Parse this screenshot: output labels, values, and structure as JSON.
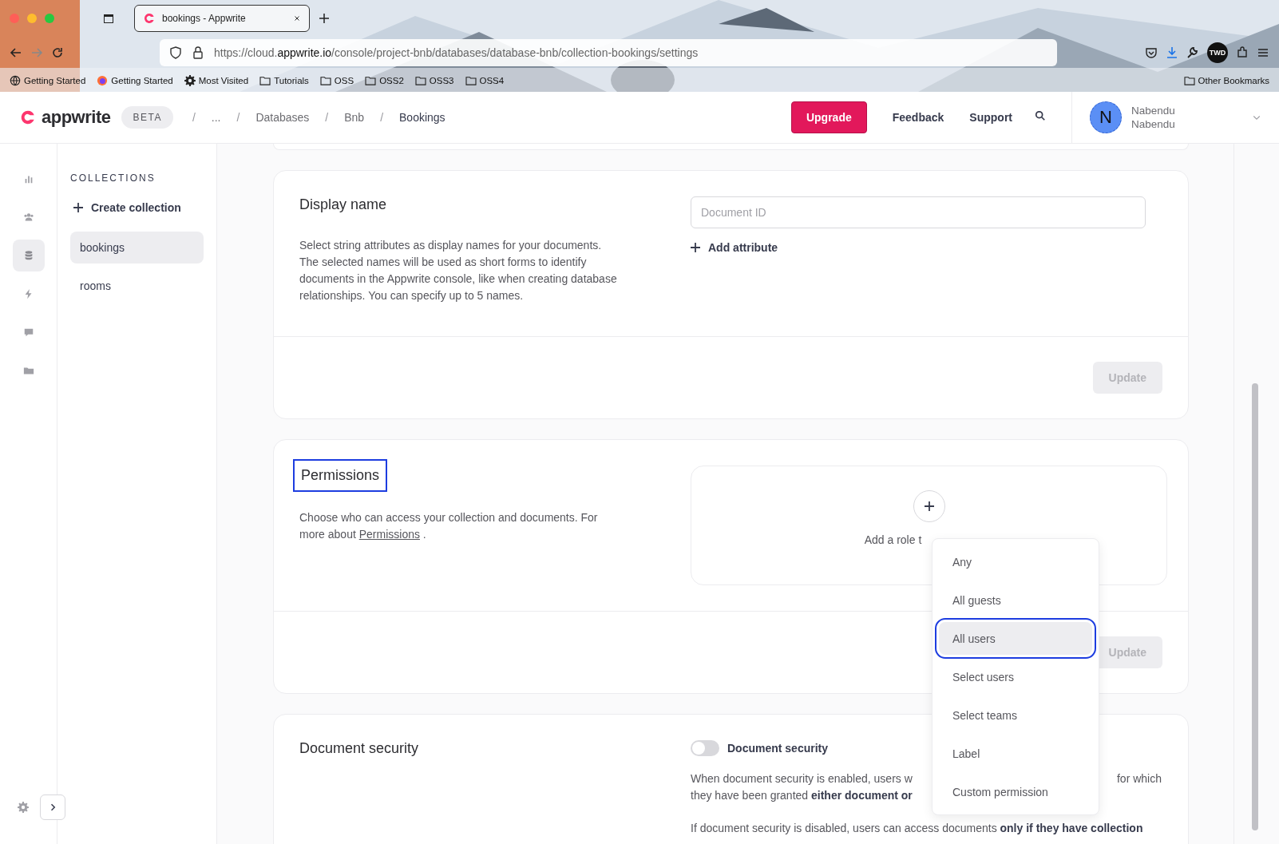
{
  "browser": {
    "tab": {
      "title": "bookings - Appwrite",
      "selected": true
    },
    "url": {
      "prefix": "https://cloud.",
      "domain": "appwrite.io",
      "path": "/console/project-bnb/databases/database-bnb/collection-bookings/settings"
    },
    "bookmarks": [
      {
        "kind": "globe",
        "label": "Getting Started"
      },
      {
        "kind": "fox",
        "label": "Getting Started"
      },
      {
        "kind": "gear",
        "label": "Most Visited"
      },
      {
        "kind": "folder",
        "label": "Tutorials"
      },
      {
        "kind": "folder",
        "label": "OSS"
      },
      {
        "kind": "folder",
        "label": "OSS2"
      },
      {
        "kind": "folder",
        "label": "OSS3"
      },
      {
        "kind": "folder",
        "label": "OSS4"
      }
    ],
    "other_bookmarks": "Other Bookmarks",
    "extension_badge": "TWD"
  },
  "header": {
    "logo": "appwrite",
    "badge": "BETA",
    "separator": "/",
    "breadcrumbs": [
      "...",
      "Databases",
      "Bnb",
      "Bookings"
    ],
    "upgrade": "Upgrade",
    "links": [
      "Feedback",
      "Support"
    ],
    "user": {
      "initial": "N",
      "name": "Nabendu",
      "subtitle": "Nabendu"
    }
  },
  "rail": [
    {
      "kind": "chart",
      "selected": false
    },
    {
      "kind": "people",
      "selected": false
    },
    {
      "kind": "database",
      "selected": true
    },
    {
      "kind": "bolt",
      "selected": false
    },
    {
      "kind": "chat",
      "selected": false
    },
    {
      "kind": "folder",
      "selected": false
    }
  ],
  "sidebar": {
    "title": "COLLECTIONS",
    "create": "Create collection",
    "items": [
      {
        "label": "bookings",
        "selected": true
      },
      {
        "label": "rooms",
        "selected": false
      }
    ]
  },
  "display_name": {
    "title": "Display name",
    "description": "Select string attributes as display names for your documents. The selected names will be used as short forms to identify documents in the Appwrite console, like when creating database relationships. You can specify up to 5 names.",
    "field": {
      "placeholder": "Document ID"
    },
    "add": "Add attribute",
    "button": {
      "label": "Update",
      "disabled": true
    }
  },
  "permissions": {
    "title": "Permissions",
    "title_highlighted": true,
    "description": "Choose who can access your collection and documents. For more about",
    "link": "Permissions",
    "after_link": ".",
    "add_role": "Add a role t",
    "button": {
      "label": "Update",
      "disabled": true
    },
    "menu": [
      {
        "label": "Any",
        "selected": false
      },
      {
        "label": "All guests",
        "selected": false
      },
      {
        "label": "All users",
        "selected": true
      },
      {
        "label": "Select users",
        "selected": false
      },
      {
        "label": "Select teams",
        "selected": false
      },
      {
        "label": "Label",
        "selected": false
      },
      {
        "label": "Custom permission",
        "selected": false
      }
    ]
  },
  "document_security": {
    "title": "Document security",
    "toggle": {
      "label": "Document security",
      "on": false
    },
    "line_1": [
      "When document security is enabled, users w",
      "for which"
    ],
    "line_2": "they have been granted **either document or**",
    "line_3": "If document security is disabled, users can access documents **only if they have collection**"
  }
}
